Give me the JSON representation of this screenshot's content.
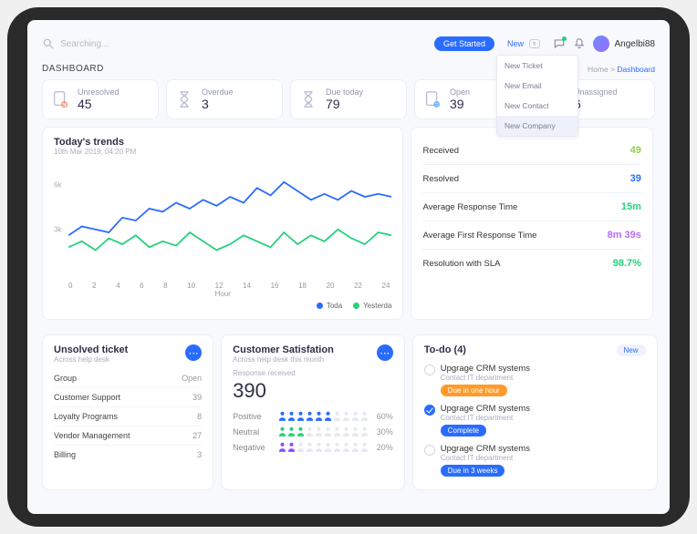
{
  "header": {
    "search_placeholder": "Searching...",
    "cta": "Get Started",
    "new_label": "New",
    "new_menu": [
      "New Ticket",
      "New Email",
      "New Contact",
      "New Company"
    ],
    "new_active_index": 3,
    "username": "Angelbi88"
  },
  "breadcrumb": {
    "dash": "DASHBOARD",
    "home": "Home",
    "sep": ">",
    "current": "Dashboard"
  },
  "stats": [
    {
      "label": "Unresolved",
      "value": "45",
      "icon": "doc-alert"
    },
    {
      "label": "Overdue",
      "value": "3",
      "icon": "hourglass"
    },
    {
      "label": "Due today",
      "value": "79",
      "icon": "hourglass-half"
    },
    {
      "label": "Open",
      "value": "39",
      "icon": "doc-plus"
    },
    {
      "label": "Unassigned",
      "value": "6",
      "icon": "hand-click"
    }
  ],
  "trends": {
    "title": "Today's trends",
    "subtitle": "10th Mar 2019, 04:20 PM",
    "legend": [
      "Toda",
      "Yesterda"
    ],
    "colors": {
      "today": "#2a6cff",
      "yesterday": "#27d07b"
    },
    "xaxis_label": "Hour"
  },
  "chart_data": {
    "type": "line",
    "categories": [
      "0",
      "2",
      "4",
      "6",
      "8",
      "10",
      "12",
      "14",
      "16",
      "18",
      "20",
      "22",
      "24"
    ],
    "xlabel": "Hour",
    "ylabel": "",
    "y_ticks": [
      "3k",
      "6k"
    ],
    "ylim": [
      0,
      8000
    ],
    "series": [
      {
        "name": "Toda",
        "color": "#2a6cff",
        "values": [
          3000,
          3600,
          3400,
          3200,
          4200,
          4000,
          4800,
          4600,
          5200,
          4800,
          5400,
          5000,
          5600,
          5200,
          6200,
          5700,
          6600,
          6000,
          5400,
          5800,
          5400,
          6000,
          5600,
          5800,
          5600
        ]
      },
      {
        "name": "Yesterda",
        "color": "#27d07b",
        "values": [
          2200,
          2600,
          2000,
          2800,
          2400,
          3000,
          2200,
          2600,
          2300,
          3200,
          2600,
          2000,
          2400,
          3000,
          2600,
          2200,
          3200,
          2400,
          3000,
          2600,
          3400,
          2800,
          2400,
          3200,
          3000
        ]
      }
    ]
  },
  "metrics": [
    {
      "label": "Received",
      "value": "49",
      "color": "#8fd14f"
    },
    {
      "label": "Resolved",
      "value": "39",
      "color": "#2a6cff"
    },
    {
      "label": "Average Response Time",
      "value": "15m",
      "color": "#27d07b"
    },
    {
      "label": "Average First Response Time",
      "value": "8m 39s",
      "color": "#b96bff"
    },
    {
      "label": "Resolution with SLA",
      "value": "98.7%",
      "color": "#27d07b"
    }
  ],
  "unsolved": {
    "title": "Unsolved ticket",
    "subtitle": "Across help desk",
    "rows": [
      {
        "label": "Group",
        "value": "Open"
      },
      {
        "label": "Customer Support",
        "value": "39"
      },
      {
        "label": "Loyalty Programs",
        "value": "8"
      },
      {
        "label": "Vendor Management",
        "value": "27"
      },
      {
        "label": "Billing",
        "value": "3"
      }
    ]
  },
  "satisfaction": {
    "title": "Customer Satisfation",
    "subtitle": "Across help desk this month",
    "response_label": "Response received",
    "response_value": "390",
    "rows": [
      {
        "label": "Positive",
        "pct": "60%",
        "fill": 6,
        "color": "#2a6cff"
      },
      {
        "label": "Neutral",
        "pct": "30%",
        "fill": 3,
        "color": "#27d07b"
      },
      {
        "label": "Negative",
        "pct": "20%",
        "fill": 2,
        "color": "#8a4bff"
      }
    ]
  },
  "todo": {
    "title": "To-do (4)",
    "new_label": "New",
    "items": [
      {
        "title": "Upgrage CRM systems",
        "sub": "Contact IT department",
        "done": false,
        "pill": "Due in one hour",
        "pill_style": "orange"
      },
      {
        "title": "Upgrage CRM systems",
        "sub": "Contact IT department",
        "done": true,
        "pill": "Complete",
        "pill_style": "blue"
      },
      {
        "title": "Upgrage CRM systems",
        "sub": "Contact IT department",
        "done": false,
        "pill": "Due in 3 weeks",
        "pill_style": "blue"
      }
    ]
  }
}
